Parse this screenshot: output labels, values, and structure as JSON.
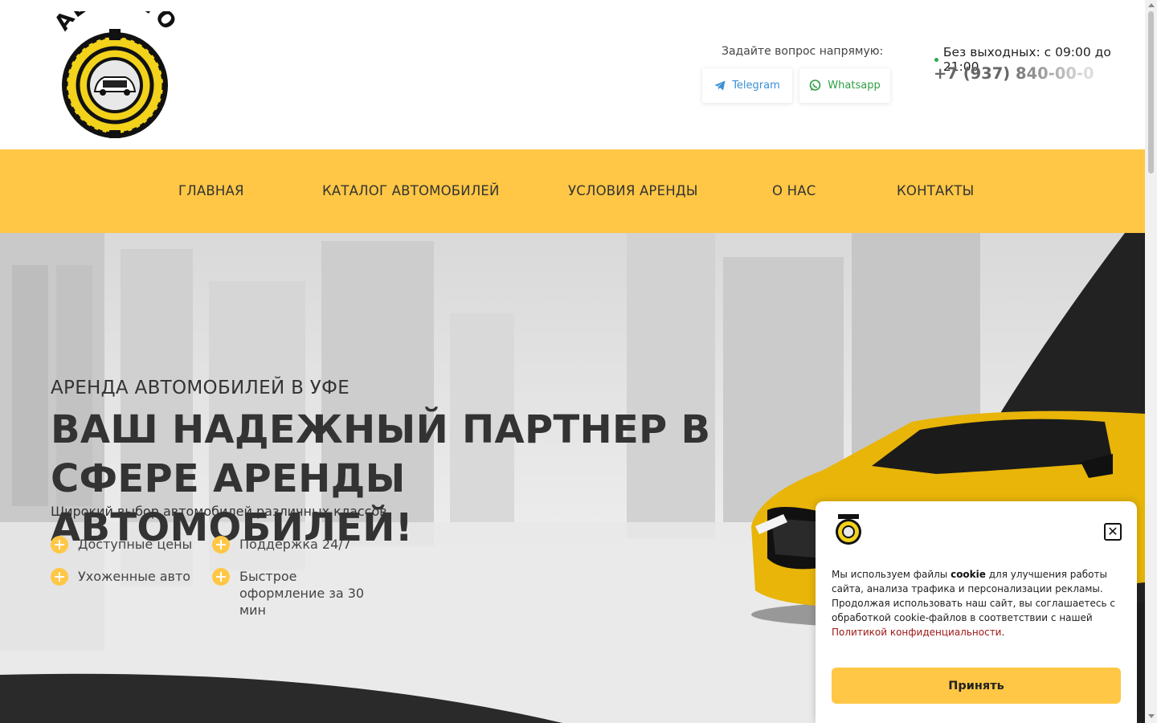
{
  "header": {
    "logo_text": "ALGAUTO",
    "ask_label": "Задайте вопрос напрямую:",
    "telegram_label": "Telegram",
    "whatsapp_label": "Whatsapp",
    "hours": "Без выходных: с 09:00 до 21:00",
    "phone_visible": "+7 (937) ",
    "phone_faded": "840-00-0"
  },
  "nav": {
    "items": [
      "ГЛАВНАЯ",
      "КАТАЛОГ АВТОМОБИЛЕЙ",
      "УСЛОВИЯ АРЕНДЫ",
      "О НАС",
      "КОНТАКТЫ"
    ]
  },
  "hero": {
    "subtitle": "АРЕНДА АВТОМОБИЛЕЙ В УФЕ",
    "title": "ВАШ НАДЕЖНЫЙ ПАРТНЕР В СФЕРЕ АРЕНДЫ АВТОМОБИЛЕЙ!",
    "description": "Широкий выбор автомобилей различных классов",
    "features": [
      "Доступные цены",
      "Поддержка 24/7",
      "Ухоженные авто",
      "Быстрое оформление за 30 мин"
    ]
  },
  "cookie": {
    "text_before": "Мы используем файлы ",
    "text_bold": "cookie",
    "text_after": " для улучшения работы сайта, анализа трафика и персонализации рекламы. Продолжая использовать наш сайт, вы соглашаетесь с обработкой cookie-файлов в соответствии с нашей ",
    "link": "Политикой конфиденциальности",
    "text_end": ".",
    "accept_label": "Принять",
    "close_glyph": "✕"
  },
  "colors": {
    "accent": "#ffc745",
    "link": "#a01818",
    "telegram": "#3a8fd6",
    "whatsapp": "#2f9e44"
  }
}
